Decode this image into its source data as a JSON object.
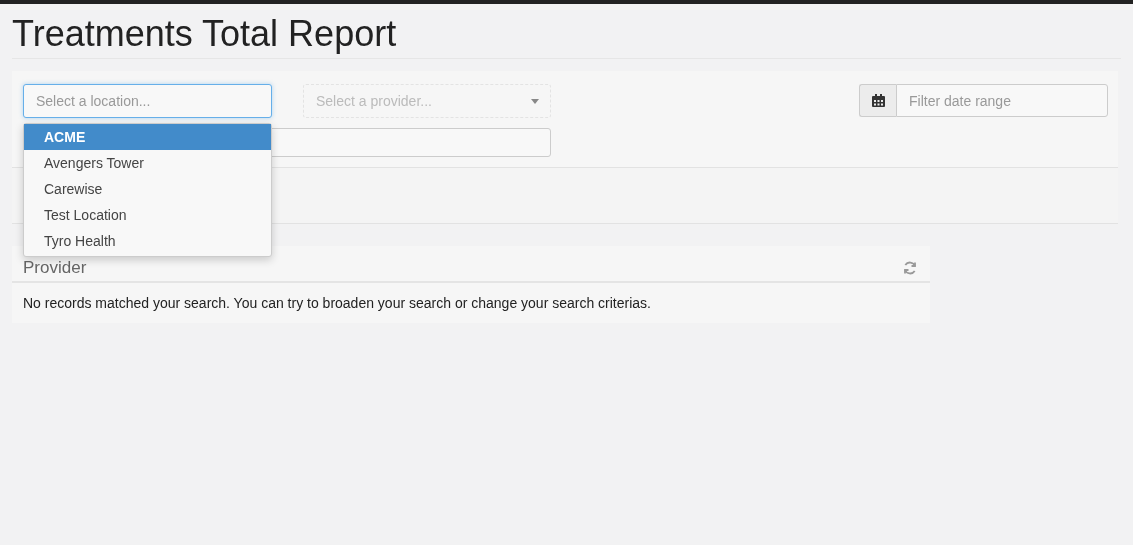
{
  "title": "Treatments Total Report",
  "filters": {
    "location": {
      "placeholder": "Select a location...",
      "expanded": true,
      "options": [
        {
          "label": "ACME",
          "selected": true
        },
        {
          "label": "Avengers Tower",
          "selected": false
        },
        {
          "label": "Carewise",
          "selected": false
        },
        {
          "label": "Test Location",
          "selected": false
        },
        {
          "label": "Tyro Health",
          "selected": false
        }
      ]
    },
    "provider": {
      "placeholder": "Select a provider...",
      "disabled": true
    },
    "date_range": {
      "placeholder": "Filter date range"
    }
  },
  "panel": {
    "title": "Provider",
    "message": "No records matched your search. You can try to broaden your search or change your search criterias."
  }
}
